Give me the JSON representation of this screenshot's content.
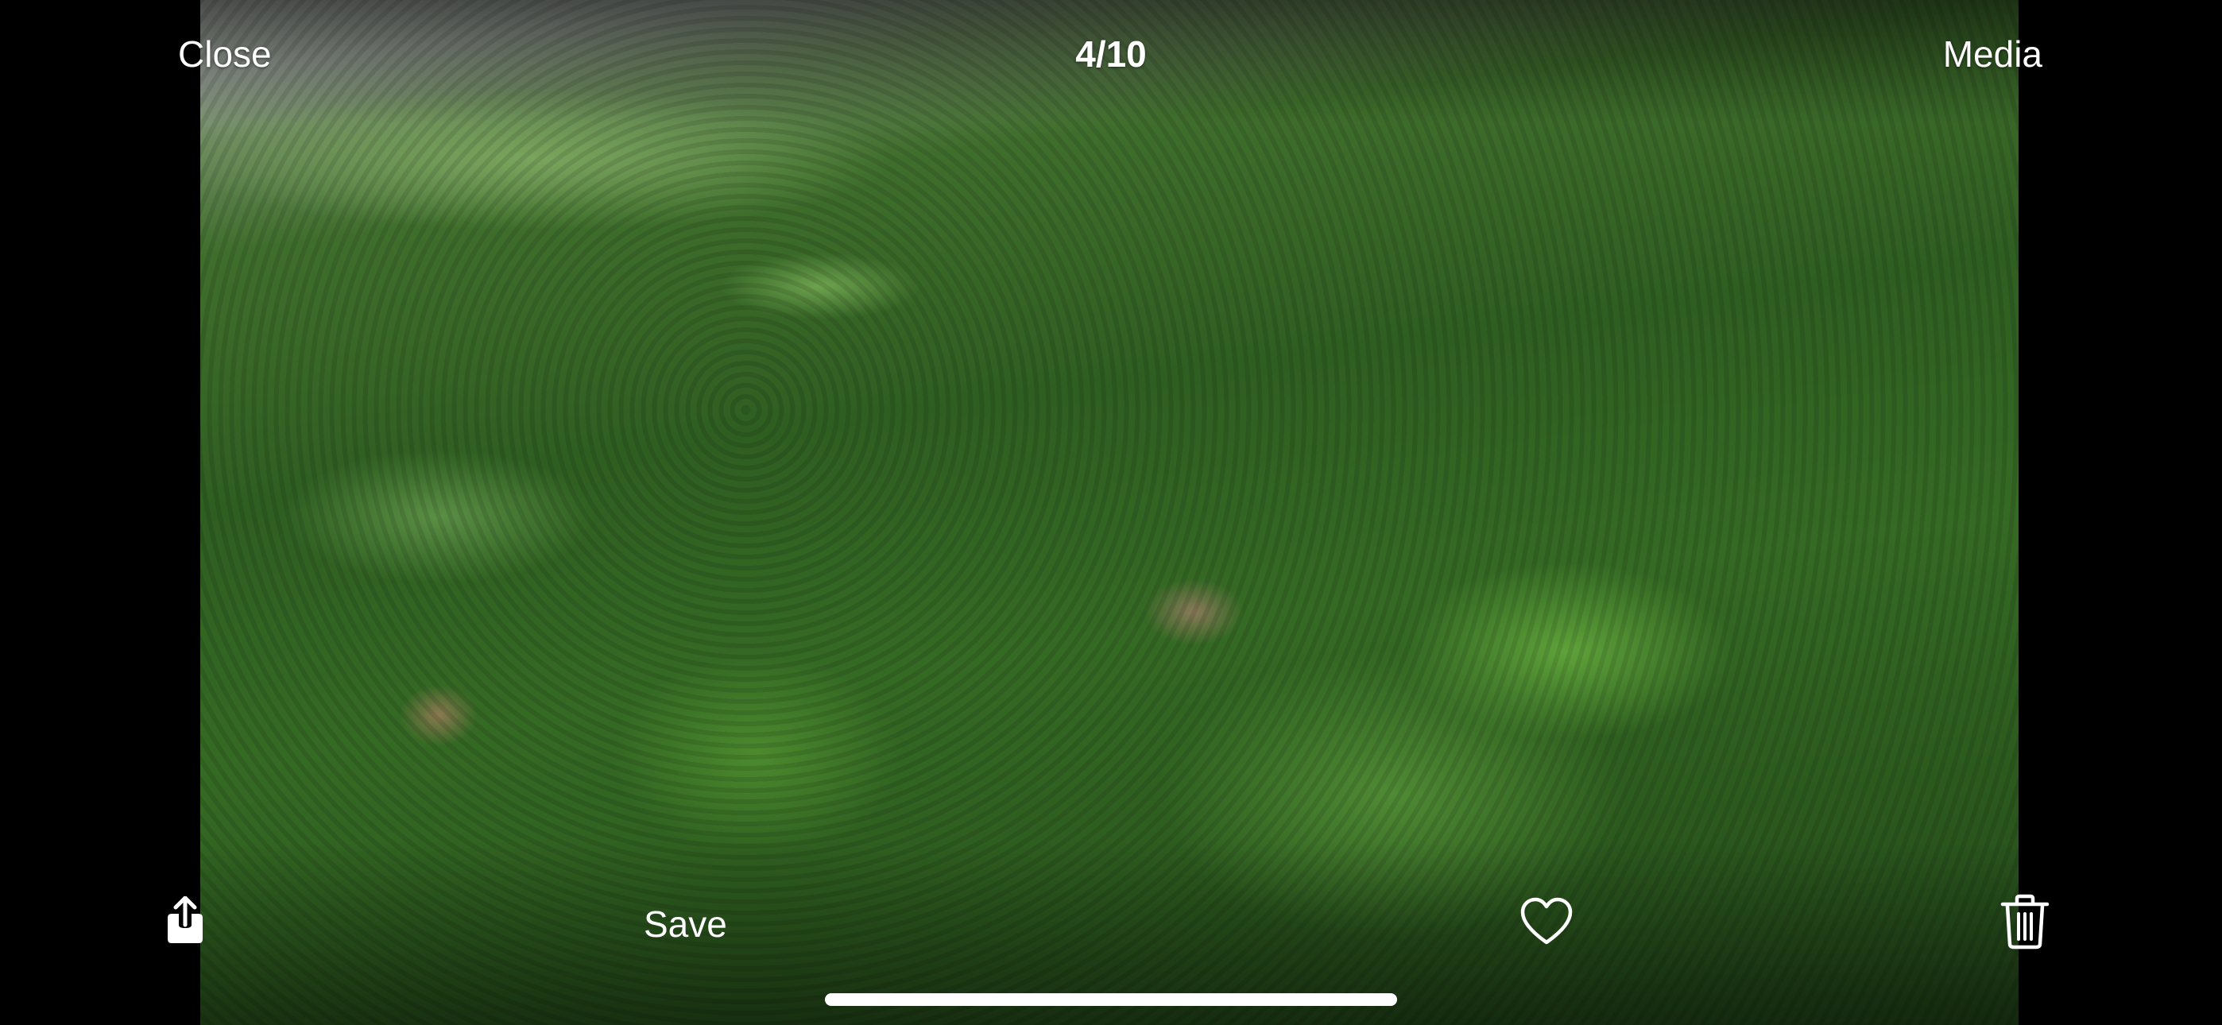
{
  "header": {
    "close_label": "Close",
    "counter": "4/10",
    "media_label": "Media"
  },
  "toolbar": {
    "share_icon": "share-icon",
    "save_label": "Save",
    "favorite_icon": "heart-icon",
    "delete_icon": "trash-icon"
  },
  "colors": {
    "background": "#000000",
    "text": "#ffffff"
  }
}
